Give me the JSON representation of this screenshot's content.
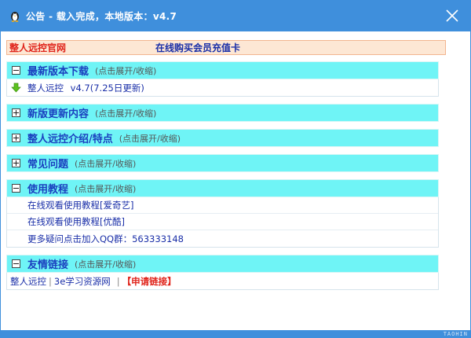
{
  "window": {
    "title": "公告 - 载入完成，本地版本：v4.7"
  },
  "linkbar": {
    "official_site": "整人远控官网",
    "buy_card": "在线购买会员充值卡"
  },
  "sections": [
    {
      "title": "最新版本下载",
      "hint": "(点击展开/收缩)",
      "expanded": true,
      "rows": [
        {
          "icon": "download-arrow-icon",
          "label": "整人远控",
          "version": "v4.7(7.25日更新)"
        }
      ]
    },
    {
      "title": "新版更新内容",
      "hint": "(点击展开/收缩)",
      "expanded": false
    },
    {
      "title": "整人远控介绍/特点",
      "hint": "(点击展开/收缩)",
      "expanded": false
    },
    {
      "title": "常见问题",
      "hint": "(点击展开/收缩)",
      "expanded": false
    },
    {
      "title": "使用教程",
      "hint": "(点击展开/收缩)",
      "expanded": true,
      "rows": [
        {
          "label": "在线观看使用教程[爱奇艺]"
        },
        {
          "label": "在线观看使用教程[优酷]"
        },
        {
          "label": "更多疑问点击加入QQ群：",
          "number": "563333148"
        }
      ]
    },
    {
      "title": "友情链接",
      "hint": "(点击展开/收缩)",
      "expanded": true,
      "links": [
        "整人远控",
        "3e学习资源网"
      ],
      "apply_link": "【申请链接】"
    }
  ],
  "footer": {
    "watermark": "TAOHIN"
  },
  "colors": {
    "titlebar": "#3f8fdc",
    "section_header": "#6ff4f6",
    "link_text": "#1a2fa8",
    "highlight_red": "#e0241b",
    "linkbar_bg": "#fde7d4"
  }
}
